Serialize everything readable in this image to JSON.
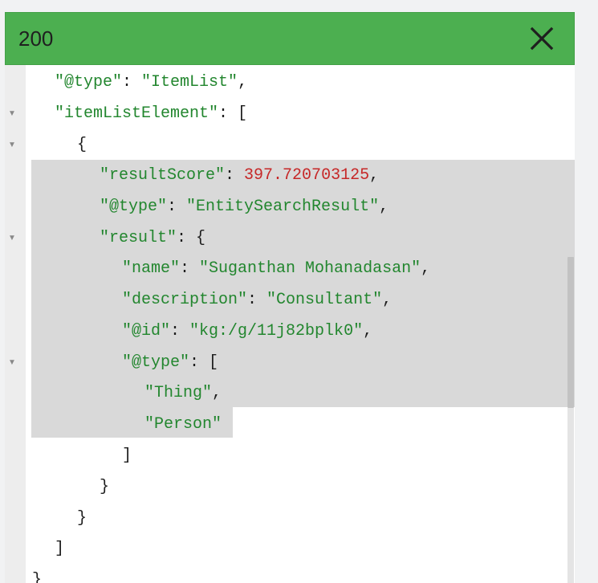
{
  "header": {
    "status_code": "200",
    "close_icon": "close-icon",
    "color": "#4caf50"
  },
  "code": {
    "type_key": "\"@type\"",
    "type_value": "\"ItemList\"",
    "item_list_key": "\"itemListElement\"",
    "result_score_key": "\"resultScore\"",
    "result_score_value": "397.720703125",
    "entity_type_key": "\"@type\"",
    "entity_type_value": "\"EntitySearchResult\"",
    "result_key": "\"result\"",
    "name_key": "\"name\"",
    "name_value": "\"Suganthan Mohanadasan\"",
    "description_key": "\"description\"",
    "description_value": "\"Consultant\"",
    "id_key": "\"@id\"",
    "id_value": "\"kg:/g/11j82bplk0\"",
    "types_key": "\"@type\"",
    "type_thing": "\"Thing\"",
    "type_person": "\"Person\""
  },
  "colors": {
    "string": "#22862e",
    "number": "#c62828",
    "selection": "#d9d9d9"
  }
}
